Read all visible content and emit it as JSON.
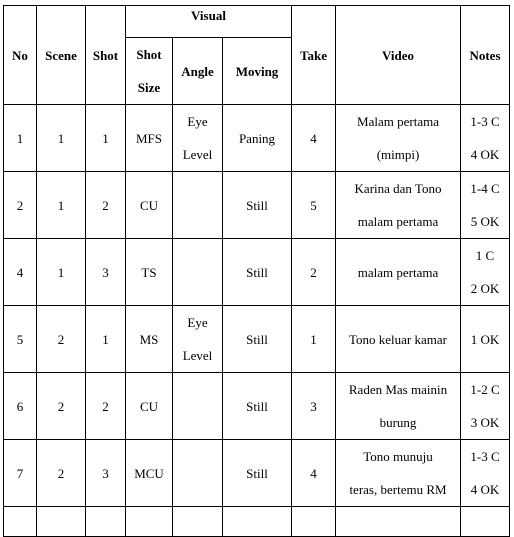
{
  "table": {
    "headers": {
      "no": "No",
      "scene": "Scene",
      "shot": "Shot",
      "visual": "Visual",
      "visual_sub": {
        "shot_size_line1": "Shot",
        "shot_size_line2": "Size",
        "angle": "Angle",
        "moving": "Moving"
      },
      "take": "Take",
      "video": "Video",
      "notes": "Notes"
    },
    "rows": [
      {
        "no": "1",
        "scene": "1",
        "shot": "1",
        "shot_size": "MFS",
        "angle_line1": "Eye",
        "angle_line2": "Level",
        "moving": "Paning",
        "take": "4",
        "video_line1": "Malam pertama",
        "video_line2": "(mimpi)",
        "notes_line1": "1-3 C",
        "notes_line2": "4 OK"
      },
      {
        "no": "2",
        "scene": "1",
        "shot": "2",
        "shot_size": "CU",
        "angle_line1": "",
        "angle_line2": "",
        "moving": "Still",
        "take": "5",
        "video_line1": "Karina dan Tono",
        "video_line2": "malam pertama",
        "notes_line1": "1-4 C",
        "notes_line2": "5 OK"
      },
      {
        "no": "4",
        "scene": "1",
        "shot": "3",
        "shot_size": "TS",
        "angle_line1": "",
        "angle_line2": "",
        "moving": "Still",
        "take": "2",
        "video_line1": "malam pertama",
        "video_line2": "",
        "notes_line1": "1 C",
        "notes_line2": "2 OK"
      },
      {
        "no": "5",
        "scene": "2",
        "shot": "1",
        "shot_size": "MS",
        "angle_line1": "Eye",
        "angle_line2": "Level",
        "moving": "Still",
        "take": "1",
        "video_line1": "Tono keluar kamar",
        "video_line2": "",
        "notes_line1": "1 OK",
        "notes_line2": ""
      },
      {
        "no": "6",
        "scene": "2",
        "shot": "2",
        "shot_size": "CU",
        "angle_line1": "",
        "angle_line2": "",
        "moving": "Still",
        "take": "3",
        "video_line1": "Raden Mas mainin",
        "video_line2": "burung",
        "notes_line1": "1-2 C",
        "notes_line2": "3 OK"
      },
      {
        "no": "7",
        "scene": "2",
        "shot": "3",
        "shot_size": "MCU",
        "angle_line1": "",
        "angle_line2": "",
        "moving": "Still",
        "take": "4",
        "video_line1": "Tono munuju",
        "video_line2": "teras, bertemu RM",
        "notes_line1": "1-3 C",
        "notes_line2": "4 OK"
      }
    ]
  }
}
